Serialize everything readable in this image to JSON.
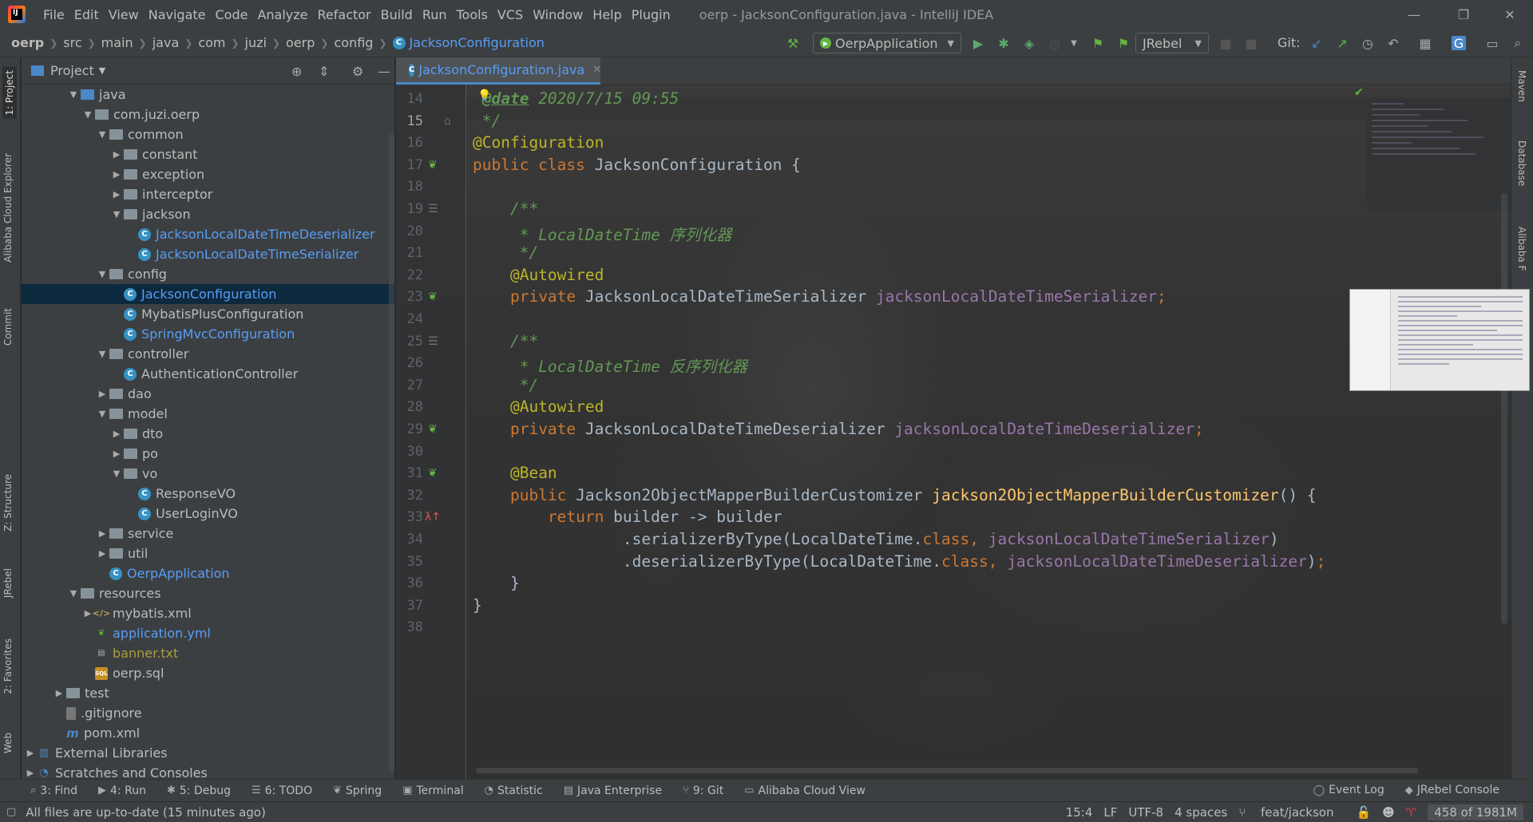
{
  "menubar": {
    "items": [
      "File",
      "Edit",
      "View",
      "Navigate",
      "Code",
      "Analyze",
      "Refactor",
      "Build",
      "Run",
      "Tools",
      "VCS",
      "Window",
      "Help",
      "Plugin"
    ],
    "title": "oerp - JacksonConfiguration.java - IntelliJ IDEA"
  },
  "navbar": {
    "crumbs": [
      "oerp",
      "src",
      "main",
      "java",
      "com",
      "juzi",
      "oerp",
      "config",
      "JacksonConfiguration"
    ],
    "run_config": "OerpApplication",
    "jrebel": "JRebel",
    "git_label": "Git:"
  },
  "left_stripe": [
    "1: Project",
    "Alibaba Cloud Explorer",
    "Commit",
    "Z: Structure",
    "JRebel",
    "2: Favorites",
    "Web"
  ],
  "right_stripe": [
    "Maven",
    "Database",
    "Alibaba F"
  ],
  "project": {
    "header": "Project",
    "tree": [
      {
        "label": "java",
        "depth": 3,
        "arrow": "open",
        "icon": "folder-blue"
      },
      {
        "label": "com.juzi.oerp",
        "depth": 4,
        "arrow": "open",
        "icon": "folder"
      },
      {
        "label": "common",
        "depth": 5,
        "arrow": "open",
        "icon": "folder"
      },
      {
        "label": "constant",
        "depth": 6,
        "arrow": "closed",
        "icon": "folder"
      },
      {
        "label": "exception",
        "depth": 6,
        "arrow": "closed",
        "icon": "folder"
      },
      {
        "label": "interceptor",
        "depth": 6,
        "arrow": "closed",
        "icon": "folder"
      },
      {
        "label": "jackson",
        "depth": 6,
        "arrow": "open",
        "icon": "folder"
      },
      {
        "label": "JacksonLocalDateTimeDeserializer",
        "depth": 7,
        "arrow": "",
        "icon": "class",
        "color": "blue"
      },
      {
        "label": "JacksonLocalDateTimeSerializer",
        "depth": 7,
        "arrow": "",
        "icon": "class",
        "color": "blue"
      },
      {
        "label": "config",
        "depth": 5,
        "arrow": "open",
        "icon": "folder"
      },
      {
        "label": "JacksonConfiguration",
        "depth": 6,
        "arrow": "",
        "icon": "class",
        "color": "blue",
        "selected": true
      },
      {
        "label": "MybatisPlusConfiguration",
        "depth": 6,
        "arrow": "",
        "icon": "class"
      },
      {
        "label": "SpringMvcConfiguration",
        "depth": 6,
        "arrow": "",
        "icon": "class",
        "color": "blue"
      },
      {
        "label": "controller",
        "depth": 5,
        "arrow": "open",
        "icon": "folder"
      },
      {
        "label": "AuthenticationController",
        "depth": 6,
        "arrow": "",
        "icon": "class"
      },
      {
        "label": "dao",
        "depth": 5,
        "arrow": "closed",
        "icon": "folder"
      },
      {
        "label": "model",
        "depth": 5,
        "arrow": "open",
        "icon": "folder"
      },
      {
        "label": "dto",
        "depth": 6,
        "arrow": "closed",
        "icon": "folder"
      },
      {
        "label": "po",
        "depth": 6,
        "arrow": "closed",
        "icon": "folder"
      },
      {
        "label": "vo",
        "depth": 6,
        "arrow": "open",
        "icon": "folder"
      },
      {
        "label": "ResponseVO",
        "depth": 7,
        "arrow": "",
        "icon": "class"
      },
      {
        "label": "UserLoginVO",
        "depth": 7,
        "arrow": "",
        "icon": "class"
      },
      {
        "label": "service",
        "depth": 5,
        "arrow": "closed",
        "icon": "folder"
      },
      {
        "label": "util",
        "depth": 5,
        "arrow": "closed",
        "icon": "folder"
      },
      {
        "label": "OerpApplication",
        "depth": 5,
        "arrow": "",
        "icon": "class-run",
        "color": "blue"
      },
      {
        "label": "resources",
        "depth": 3,
        "arrow": "open",
        "icon": "folder-res"
      },
      {
        "label": "mybatis.xml",
        "depth": 4,
        "arrow": "closed",
        "icon": "xml"
      },
      {
        "label": "application.yml",
        "depth": 4,
        "arrow": "",
        "icon": "yml",
        "color": "blue"
      },
      {
        "label": "banner.txt",
        "depth": 4,
        "arrow": "",
        "icon": "txt",
        "color": "olive"
      },
      {
        "label": "oerp.sql",
        "depth": 4,
        "arrow": "",
        "icon": "sql"
      },
      {
        "label": "test",
        "depth": 2,
        "arrow": "closed",
        "icon": "folder"
      },
      {
        "label": ".gitignore",
        "depth": 2,
        "arrow": "",
        "icon": "git"
      },
      {
        "label": "pom.xml",
        "depth": 2,
        "arrow": "",
        "icon": "m"
      },
      {
        "label": "External Libraries",
        "depth": 0,
        "arrow": "closed",
        "icon": "lib"
      },
      {
        "label": "Scratches and Consoles",
        "depth": 0,
        "arrow": "closed",
        "icon": "scratch"
      }
    ]
  },
  "editor": {
    "tab_label": "JacksonConfiguration.java",
    "current_line": 15,
    "lines": [
      {
        "n": 14,
        "html": "<span class=\"cmt\"> </span><span class=\"tag\">@date</span><span class=\"cmt\"> 2020/7/15 09:55</span>"
      },
      {
        "n": 15,
        "html": "<span class=\"cmt\"> */</span>"
      },
      {
        "n": 16,
        "html": "<span class=\"ann\">@Configuration</span>"
      },
      {
        "n": 17,
        "html": "<span class=\"kw\">public class </span>JacksonConfiguration {"
      },
      {
        "n": 18,
        "html": ""
      },
      {
        "n": 19,
        "html": "    <span class=\"cmt\">/**</span>"
      },
      {
        "n": 20,
        "html": "    <span class=\"cmt\"> * LocalDateTime 序列化器</span>"
      },
      {
        "n": 21,
        "html": "    <span class=\"cmt\"> */</span>"
      },
      {
        "n": 22,
        "html": "    <span class=\"ann\">@Autowired</span>"
      },
      {
        "n": 23,
        "html": "    <span class=\"kw\">private </span>JacksonLocalDateTimeSerializer <span class=\"fld\">jacksonLocalDateTimeSerializer</span><span class=\"kw\">;</span>"
      },
      {
        "n": 24,
        "html": ""
      },
      {
        "n": 25,
        "html": "    <span class=\"cmt\">/**</span>"
      },
      {
        "n": 26,
        "html": "    <span class=\"cmt\"> * LocalDateTime 反序列化器</span>"
      },
      {
        "n": 27,
        "html": "    <span class=\"cmt\"> */</span>"
      },
      {
        "n": 28,
        "html": "    <span class=\"ann\">@Autowired</span>"
      },
      {
        "n": 29,
        "html": "    <span class=\"kw\">private </span>JacksonLocalDateTimeDeserializer <span class=\"fld\">jacksonLocalDateTimeDeserializer</span><span class=\"kw\">;</span>"
      },
      {
        "n": 30,
        "html": ""
      },
      {
        "n": 31,
        "html": "    <span class=\"ann\">@Bean</span>"
      },
      {
        "n": 32,
        "html": "    <span class=\"kw\">public </span>Jackson2ObjectMapperBuilderCustomizer <span class=\"mth\">jackson2ObjectMapperBuilderCustomizer</span>() {"
      },
      {
        "n": 33,
        "html": "        <span class=\"kw\">return </span>builder -&gt; builder"
      },
      {
        "n": 34,
        "html": "                .serializerByType(LocalDateTime.<span class=\"kw\">class, </span><span class=\"fld\">jacksonLocalDateTimeSerializer</span>)"
      },
      {
        "n": 35,
        "html": "                .deserializerByType(LocalDateTime.<span class=\"kw\">class, </span><span class=\"fld\">jacksonLocalDateTimeDeserializer</span>)<span class=\"kw\">;</span>"
      },
      {
        "n": 36,
        "html": "    }"
      },
      {
        "n": 37,
        "html": "}"
      },
      {
        "n": 38,
        "html": ""
      }
    ]
  },
  "tool_tabs": [
    {
      "label": "3: Find",
      "icon": "⌕"
    },
    {
      "label": "4: Run",
      "icon": "▶"
    },
    {
      "label": "5: Debug",
      "icon": "✱"
    },
    {
      "label": "6: TODO",
      "icon": "☰"
    },
    {
      "label": "Spring",
      "icon": "❦"
    },
    {
      "label": "Terminal",
      "icon": "▣"
    },
    {
      "label": "Statistic",
      "icon": "◔"
    },
    {
      "label": "Java Enterprise",
      "icon": "▤"
    },
    {
      "label": "9: Git",
      "icon": "⑂"
    },
    {
      "label": "Alibaba Cloud View",
      "icon": "▭"
    }
  ],
  "tool_tabs_right": [
    {
      "label": "Event Log",
      "icon": "◯"
    },
    {
      "label": "JRebel Console",
      "icon": "◆"
    }
  ],
  "status": {
    "message": "All files are up-to-date (15 minutes ago)",
    "position": "15:4",
    "line_sep": "LF",
    "encoding": "UTF-8",
    "indent": "4 spaces",
    "branch": "feat/jackson",
    "memory": "458 of 1981M"
  },
  "colors": {
    "accent": "#4a88c7",
    "selection": "#0d293e",
    "keyword": "#cc7832",
    "annotation": "#bbb529",
    "comment": "#629755",
    "field": "#9876aa",
    "method": "#ffc66d"
  }
}
